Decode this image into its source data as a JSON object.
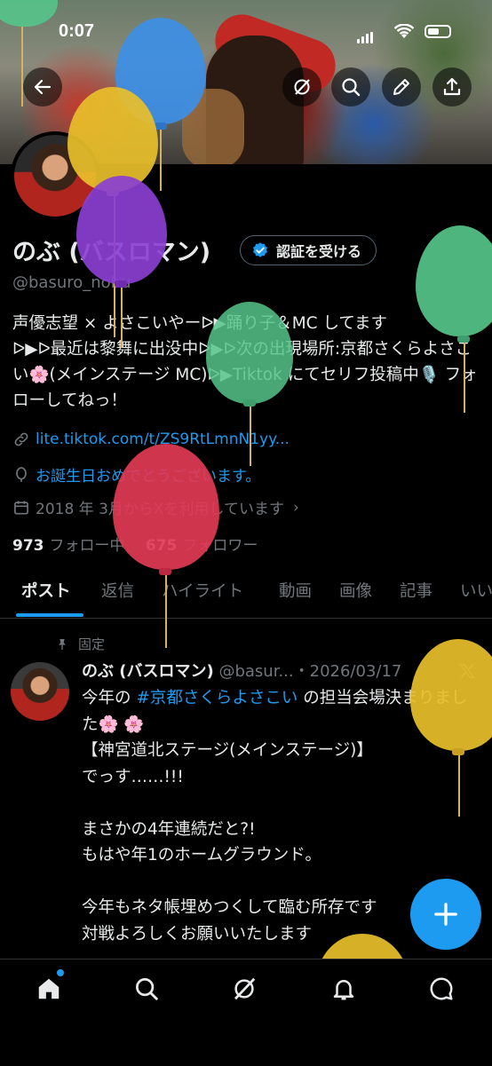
{
  "status_bar": {
    "time": "0:07"
  },
  "header": {
    "back_icon": "arrow-left-icon",
    "actions": [
      "grok-icon",
      "search-icon",
      "edit-icon",
      "share-icon"
    ]
  },
  "profile": {
    "name": "のぶ (バスロマン)",
    "verify_button": "認証を受ける",
    "handle": "@basuro_nobu",
    "bio": "声優志望 × よさこいやーᐅ▶踊り子＆MC してます\nᐅ▶ᐅ最近は黎舞に出没中ᐅ▶ᐅ次の出現場所:京都さくらよさこい🌸(メインステージ MC)ᐅ▶Tiktok にてセリフ投稿中🎙️ フォローしてねっ！",
    "link": "lite.tiktok.com/t/ZS9RtLmnN1yy...",
    "birthday": "お誕生日おめでとうございます。",
    "joined": "2018 年 3月からXを利用しています",
    "following_count": "973",
    "following_label": "フォロー中",
    "followers_count": "675",
    "followers_label": "フォロワー"
  },
  "tabs": [
    "ポスト",
    "返信",
    "ハイライト",
    "動画",
    "画像",
    "記事",
    "いい"
  ],
  "post": {
    "pinned_label": "固定",
    "author": "のぶ (バスロマン)",
    "handle_date": "@basur...・2026/03/17",
    "line1_pre": "今年の ",
    "hashtag": "#京都さくらよさこい",
    "line1_post": " の担当会場決まりました🌸 🌸",
    "rest": "\n【神宮道北ステージ(メインステージ)】\nでっす……!!!\n\nまさかの4年連続だと?!\nもはや年1のホームグラウンド。\n\n今年もネタ帳埋めつくして臨む所存です\n対戦よろしくお願いいたします"
  },
  "fab_icon": "plus-icon",
  "bottom_nav": [
    "home-icon",
    "search-icon",
    "grok-icon",
    "bell-icon",
    "messages-icon"
  ],
  "colors": {
    "accent": "#1d9bf0",
    "background": "#000000",
    "text": "#e7e9ea",
    "muted": "#71767b"
  }
}
